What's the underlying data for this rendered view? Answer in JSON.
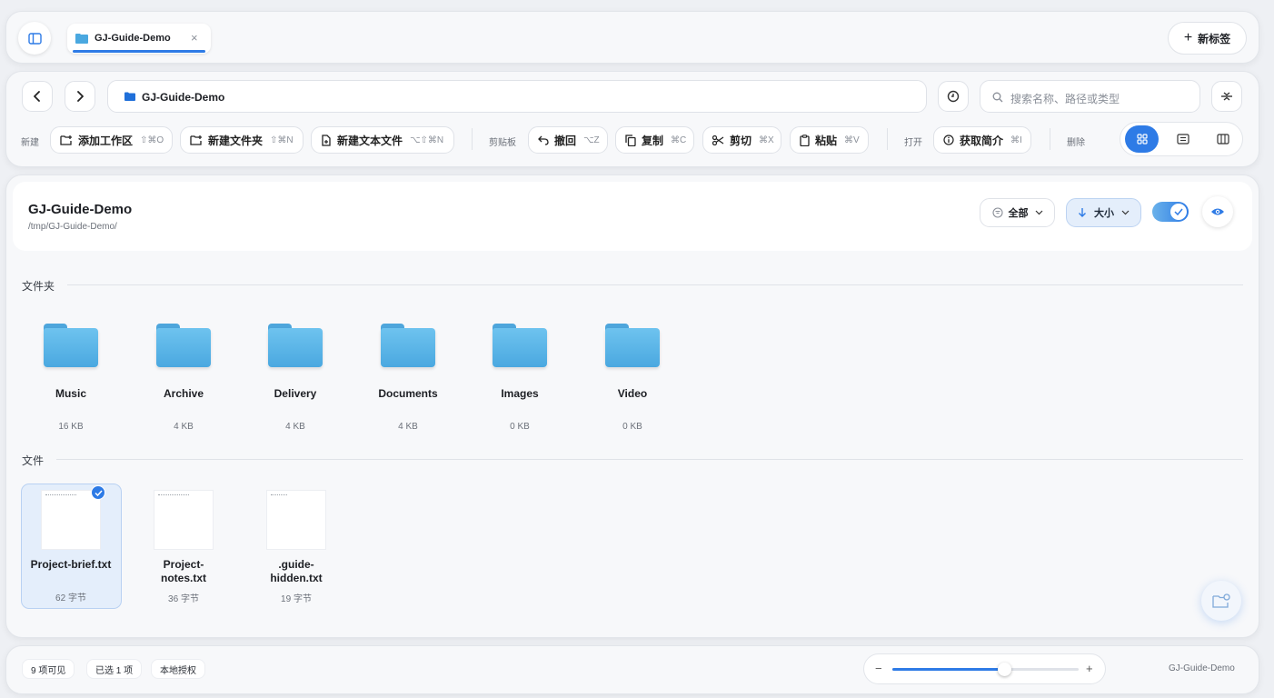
{
  "tabbar": {
    "tab_label": "GJ-Guide-Demo",
    "new_tab_label": "新标签"
  },
  "toolbar": {
    "breadcrumb": "GJ-Guide-Demo",
    "search_placeholder": "搜索名称、路径或类型",
    "groups": {
      "new": "新建",
      "clipboard": "剪贴板",
      "open": "打开",
      "delete": "删除"
    },
    "actions": {
      "add_workspace": {
        "label": "添加工作区",
        "shortcut": "⇧⌘O"
      },
      "new_folder": {
        "label": "新建文件夹",
        "shortcut": "⇧⌘N"
      },
      "new_text_file": {
        "label": "新建文本文件",
        "shortcut": "⌥⇧⌘N"
      },
      "undo": {
        "label": "撤回",
        "shortcut": "⌥Z"
      },
      "copy": {
        "label": "复制",
        "shortcut": "⌘C"
      },
      "cut": {
        "label": "剪切",
        "shortcut": "⌘X"
      },
      "paste": {
        "label": "粘贴",
        "shortcut": "⌘V"
      },
      "get_info": {
        "label": "获取简介",
        "shortcut": "⌘I"
      }
    }
  },
  "location": {
    "title": "GJ-Guide-Demo",
    "path": "/tmp/GJ-Guide-Demo/",
    "filter_label": "全部",
    "sort_label": "大小"
  },
  "sections": {
    "folders": "文件夹",
    "files": "文件"
  },
  "folders": [
    {
      "name": "Music",
      "size": "16 KB"
    },
    {
      "name": "Archive",
      "size": "4 KB"
    },
    {
      "name": "Delivery",
      "size": "4 KB"
    },
    {
      "name": "Documents",
      "size": "4 KB"
    },
    {
      "name": "Images",
      "size": "0 KB"
    },
    {
      "name": "Video",
      "size": "0 KB"
    }
  ],
  "files": [
    {
      "name": "Project-brief.txt",
      "size": "62 字节",
      "selected": true
    },
    {
      "name": "Project-notes.txt",
      "size": "36 字节",
      "selected": false
    },
    {
      "name": ".guide-hidden.txt",
      "size": "19 字节",
      "selected": false
    }
  ],
  "status": {
    "visible": "9 项可见",
    "selected": "已选 1 项",
    "auth": "本地授权",
    "zoom_fraction": 0.6,
    "location": "GJ-Guide-Demo"
  },
  "colors": {
    "accent": "#2e7be6",
    "folder": "#5bb6ea"
  }
}
